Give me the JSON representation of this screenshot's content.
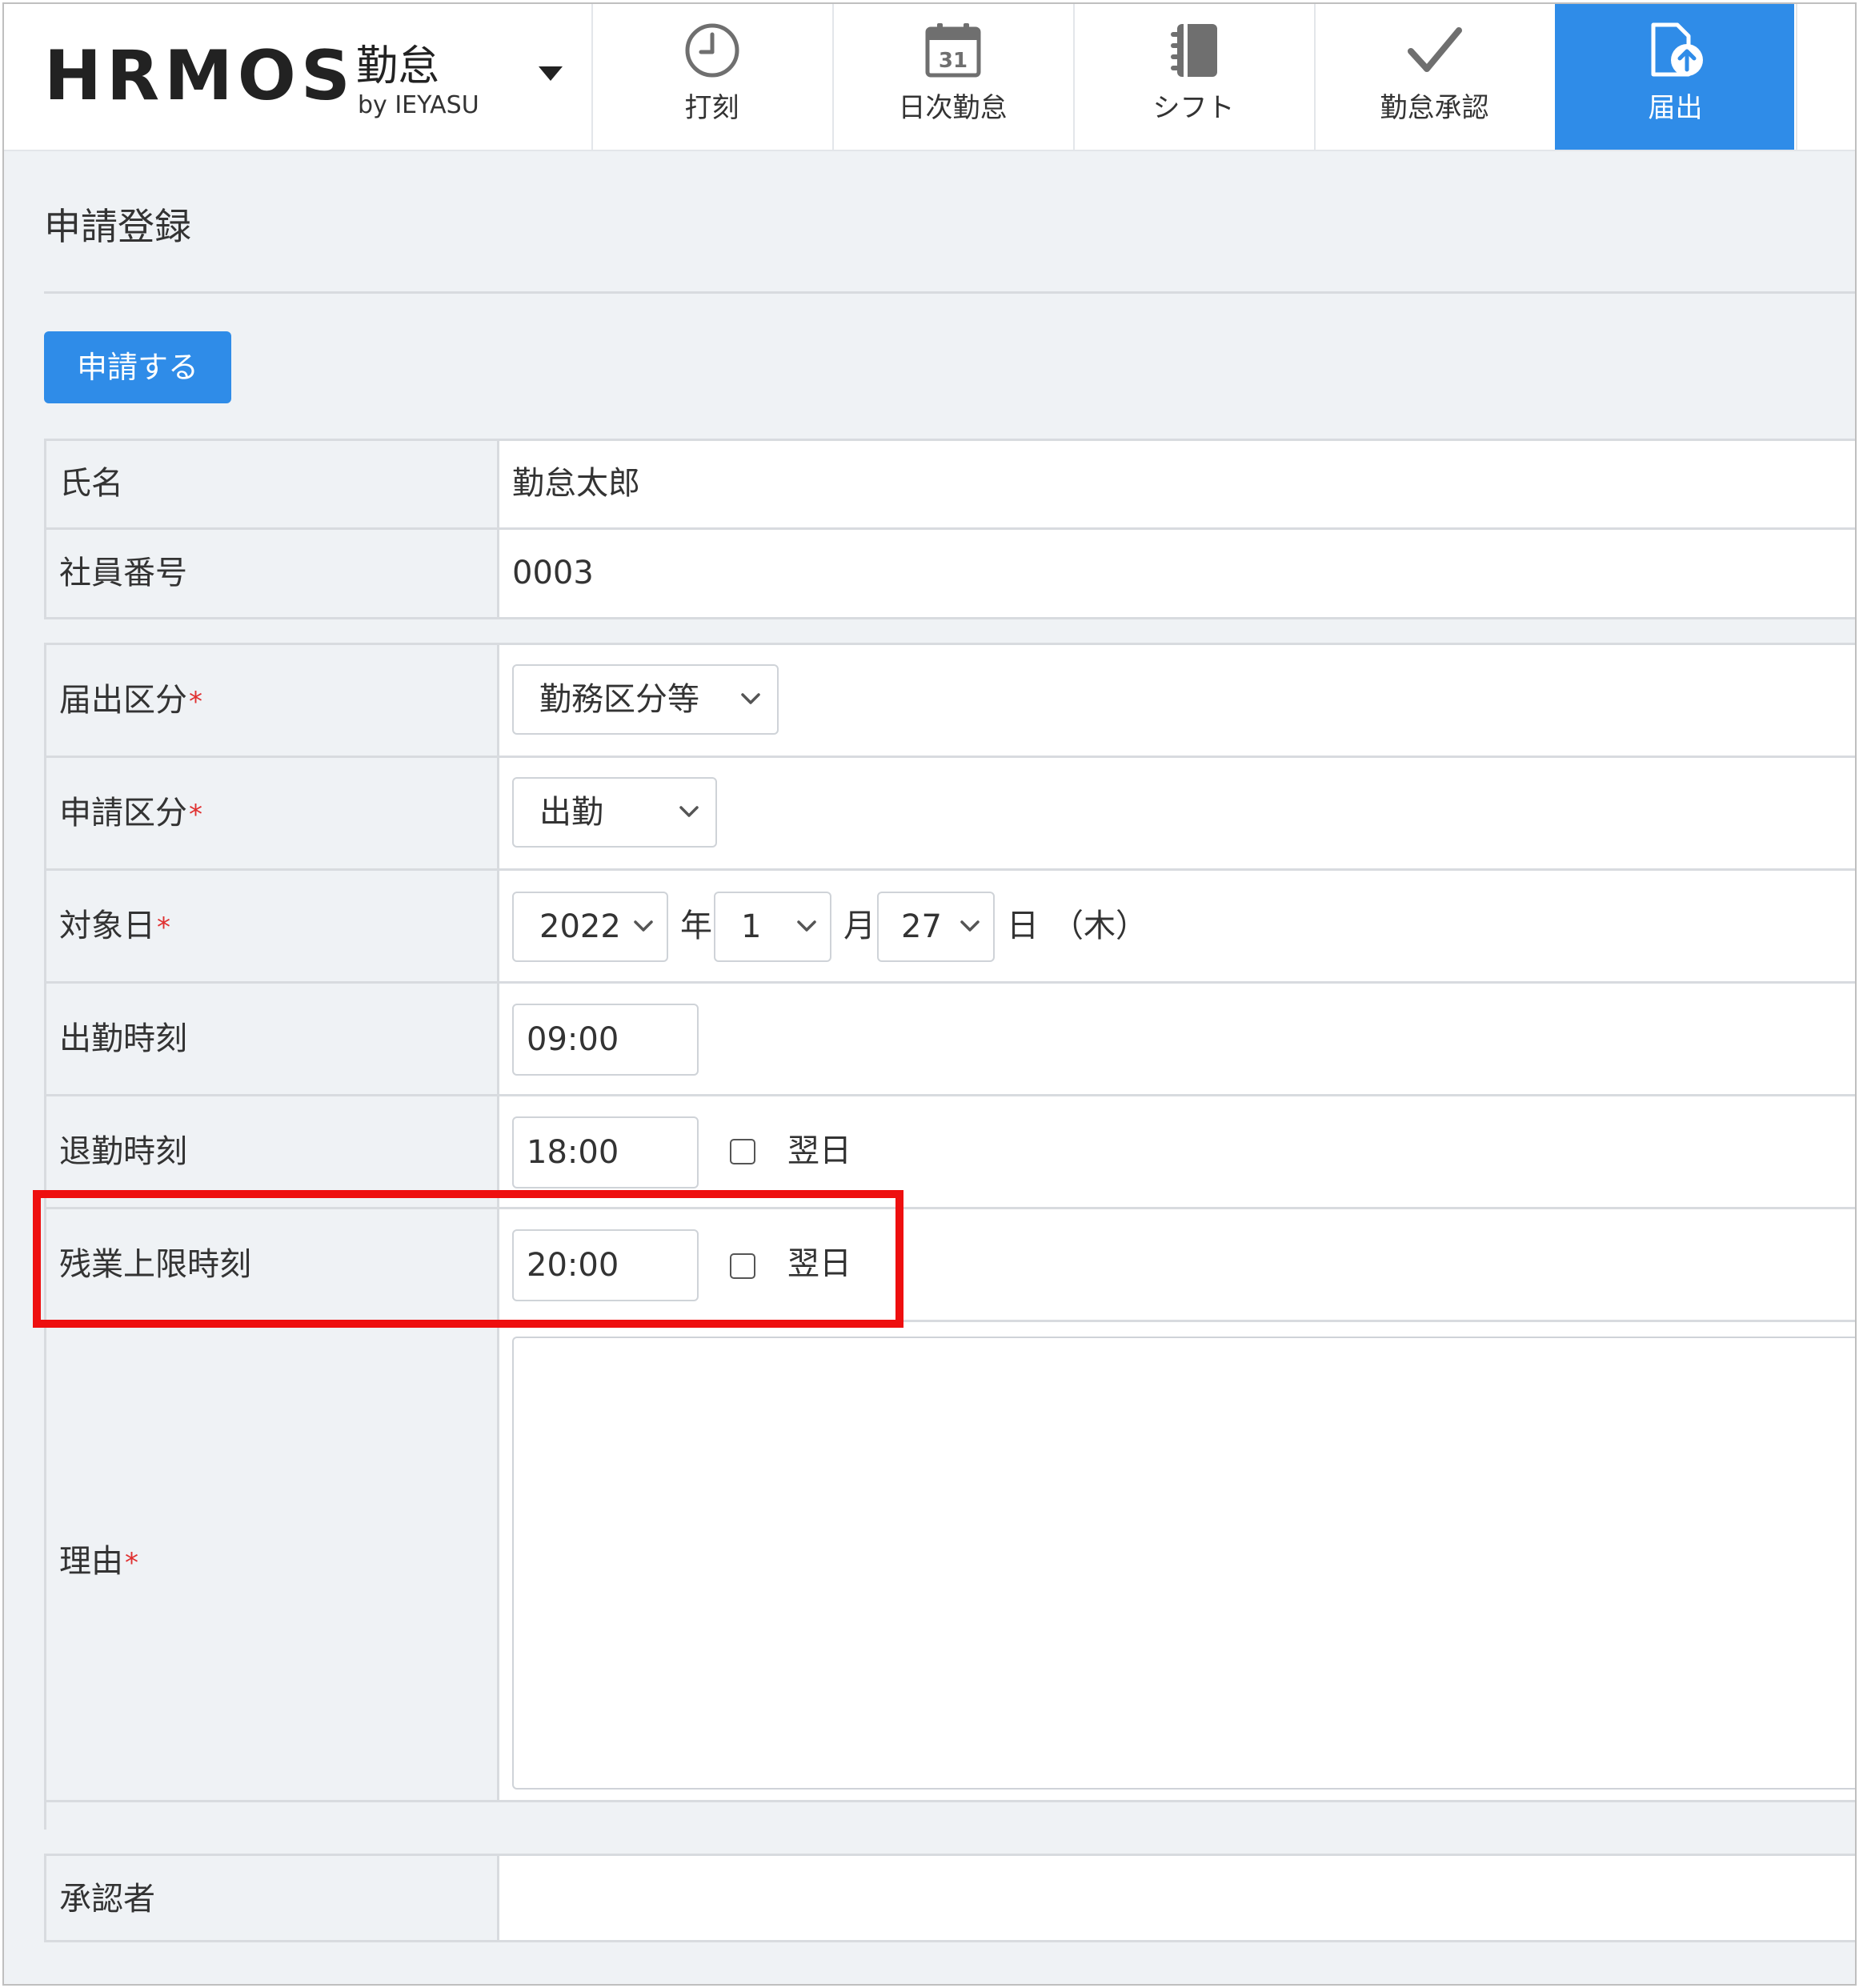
{
  "header": {
    "brand": "HRMOS",
    "brand_sub": "勤怠",
    "brand_by": "by IEYASU",
    "tabs": [
      {
        "label": "打刻",
        "icon": "clock-icon"
      },
      {
        "label": "日次勤怠",
        "icon": "calendar-icon",
        "calendar_day": "31"
      },
      {
        "label": "シフト",
        "icon": "notebook-icon"
      },
      {
        "label": "勤怠承認",
        "icon": "checkmark-icon"
      },
      {
        "label": "届出",
        "icon": "document-upload-icon",
        "active": true
      }
    ]
  },
  "page": {
    "title": "申請登録",
    "submit_label": "申請する"
  },
  "employee": {
    "name_label": "氏名",
    "name_value": "勤怠太郎",
    "number_label": "社員番号",
    "number_value": "0003"
  },
  "form": {
    "required_mark": "*",
    "category_label": "届出区分",
    "category_value": "勤務区分等",
    "apply_type_label": "申請区分",
    "apply_type_value": "出勤",
    "target_date_label": "対象日",
    "year_value": "2022",
    "year_unit": "年",
    "month_value": "1",
    "month_unit": "月",
    "day_value": "27",
    "day_unit": "日",
    "weekday": "（木）",
    "start_label": "出勤時刻",
    "start_value": "09:00",
    "end_label": "退勤時刻",
    "end_value": "18:00",
    "end_next_day_label": "翌日",
    "end_next_day_checked": false,
    "overtime_label": "残業上限時刻",
    "overtime_value": "20:00",
    "overtime_next_day_label": "翌日",
    "overtime_next_day_checked": false,
    "reason_label": "理由",
    "reason_value": "",
    "approver_label": "承認者",
    "approver_value": ""
  },
  "colors": {
    "accent": "#2f8ce8",
    "highlight": "#ee0f0f",
    "required": "#e03030",
    "label_bg": "#eff2f5"
  }
}
